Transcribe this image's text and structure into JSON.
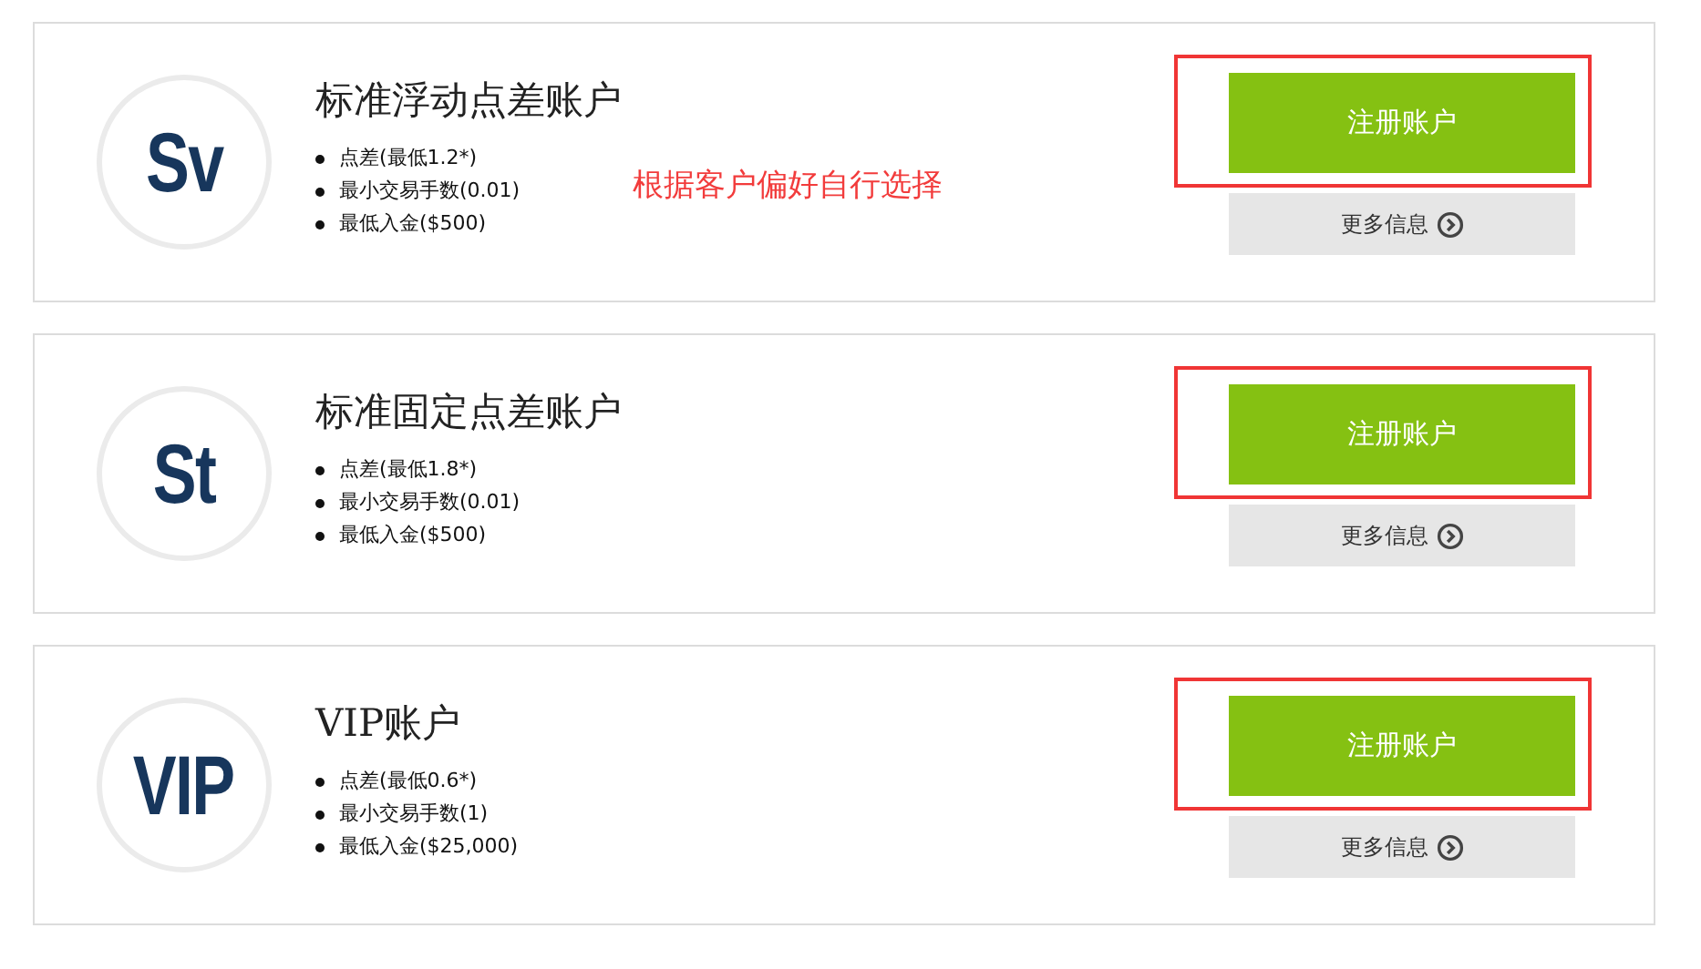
{
  "accounts": [
    {
      "logo": "Sv",
      "title": "标准浮动点差账户",
      "features": [
        "点差(最低1.2*)",
        "最小交易手数(0.01)",
        "最低入金($500)"
      ],
      "note": "根据客户偏好自行选择",
      "highlighted": true,
      "register_button": "注册账户",
      "more_button": "更多信息"
    },
    {
      "logo": "St",
      "title": "标准固定点差账户",
      "features": [
        "点差(最低1.8*)",
        "最小交易手数(0.01)",
        "最低入金($500)"
      ],
      "highlighted": true,
      "register_button": "注册账户",
      "more_button": "更多信息"
    },
    {
      "logo": "VIP",
      "title": "VIP账户",
      "features": [
        "点差(最低0.6*)",
        "最小交易手数(1)",
        "最低入金($25,000)"
      ],
      "highlighted": true,
      "register_button": "注册账户",
      "more_button": "更多信息"
    }
  ]
}
